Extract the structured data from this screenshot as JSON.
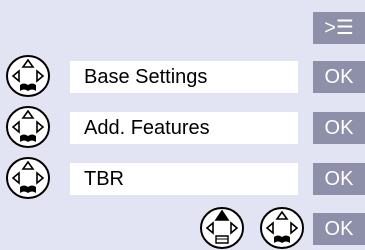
{
  "menu_key": {
    "glyph": ">☰",
    "icon": "menu-list-icon"
  },
  "steps": [
    {
      "label": "Base Settings",
      "confirm": "OK",
      "nav_icon": "nav-key-down-icon"
    },
    {
      "label": "Add. Features",
      "confirm": "OK",
      "nav_icon": "nav-key-down-icon"
    },
    {
      "label": "TBR",
      "confirm": "OK",
      "nav_icon": "nav-key-down-icon"
    }
  ],
  "final": {
    "nav_icons": [
      "nav-key-up-icon",
      "nav-key-down-icon"
    ],
    "confirm": "OK"
  },
  "colors": {
    "background": "#e2e3f3",
    "softkey": "#8e8fa8",
    "box": "#ffffff"
  }
}
